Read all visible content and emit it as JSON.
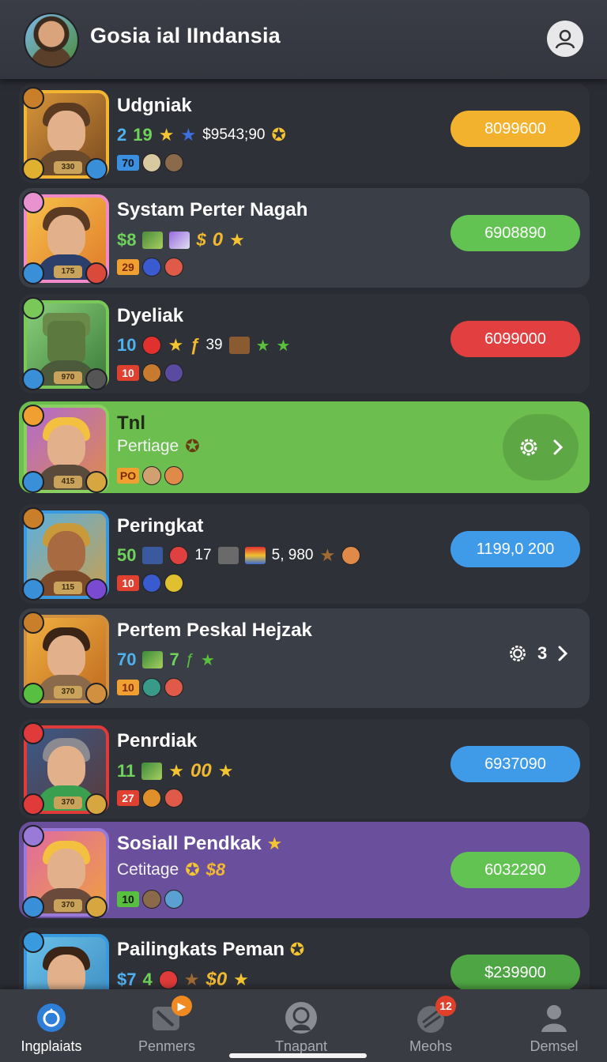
{
  "header": {
    "title": "Gosia ial IIndansia",
    "profile_icon": "user-icon"
  },
  "rows": [
    {
      "name": "Udgniak",
      "line2": [
        "2",
        "19",
        "$9543;90"
      ],
      "badges": [
        "70"
      ],
      "portrait_level": "330",
      "value": "8099600",
      "value_color": "orange"
    },
    {
      "name": "Systam Perter Nagah",
      "line2": [
        "$8"
      ],
      "badges": [
        "29"
      ],
      "portrait_level": "175",
      "value": "6908890",
      "value_color": "green"
    },
    {
      "name": "Dyeliak",
      "line2": [
        "10",
        "39"
      ],
      "badges": [
        "10"
      ],
      "portrait_level": "970",
      "value": "6099000",
      "value_color": "red"
    },
    {
      "name": "Tnl",
      "subtitle": "Pertiage",
      "badges": [
        "PO"
      ],
      "portrait_level": "415"
    },
    {
      "name": "Peringkat",
      "line2": [
        "50",
        "17",
        "5, 980"
      ],
      "badges": [
        "10"
      ],
      "portrait_level": "115",
      "value": "1199,0 200",
      "value_color": "blue"
    },
    {
      "name": "Pertem Peskal Hejzak",
      "line2": [
        "70",
        "7"
      ],
      "badges": [
        "10"
      ],
      "portrait_level": "370",
      "gear_label": "3"
    },
    {
      "name": "Penrdiak",
      "line2": [
        "11",
        "00"
      ],
      "badges": [
        "27"
      ],
      "portrait_level": "370",
      "value": "6937090",
      "value_color": "blue"
    },
    {
      "name": "Sosiall Pendkak",
      "subtitle": "Cetitage",
      "subtitle_extra": "$8",
      "badges": [
        "10"
      ],
      "portrait_level": "370",
      "value": "6032290",
      "value_color": "green"
    },
    {
      "name": "Pailingkats Peman",
      "line2": [
        "$7",
        "4",
        "$0"
      ],
      "value": "$239900",
      "value_color": "green"
    }
  ],
  "tabs": [
    {
      "label": "Ingplaiats",
      "icon": "home-icon",
      "active": true
    },
    {
      "label": "Penmers",
      "icon": "members-icon",
      "badge": ""
    },
    {
      "label": "Tnapant",
      "icon": "profile-circle-icon"
    },
    {
      "label": "Meohs",
      "icon": "messages-icon",
      "badge": "12"
    },
    {
      "label": "Demsel",
      "icon": "person-icon"
    }
  ],
  "colors": {
    "orange": "#f3b22e",
    "green": "#62c352",
    "red": "#e24040",
    "blue": "#3f9ae8",
    "highlight_green": "#6cbf4f",
    "highlight_purple": "#6a4f9c"
  }
}
